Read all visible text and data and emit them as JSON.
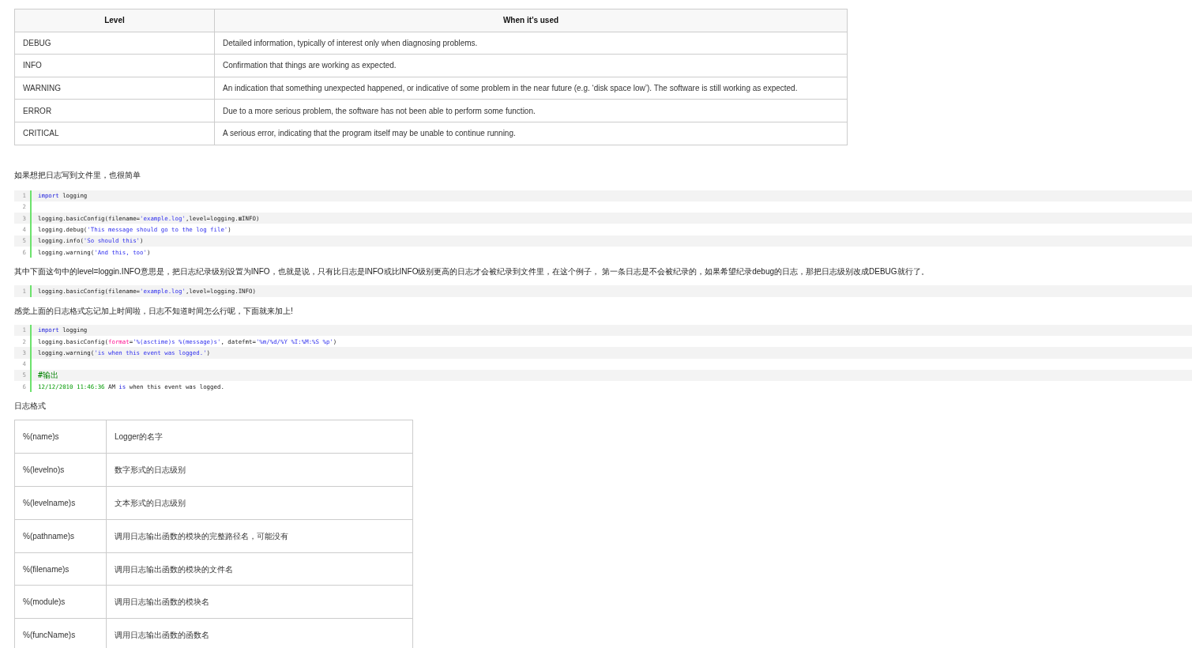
{
  "levels_table": {
    "columns": [
      "Level",
      "When it’s used"
    ],
    "rows": [
      [
        "DEBUG",
        "Detailed information, typically of interest only when diagnosing problems."
      ],
      [
        "INFO",
        "Confirmation that things are working as expected."
      ],
      [
        "WARNING",
        "An indication that something unexpected happened, or indicative of some problem in the near future (e.g. ‘disk space low’). The software is still working as expected."
      ],
      [
        "ERROR",
        "Due to a more serious problem, the software has not been able to perform some function."
      ],
      [
        "CRITICAL",
        "A serious error, indicating that the program itself may be unable to continue running."
      ]
    ]
  },
  "blocks": [
    {
      "kind": "para",
      "text": "如果想把日志写到文件里，也很简单"
    },
    {
      "kind": "code",
      "lines": [
        {
          "number": "1",
          "tokens": [
            {
              "kind": "keyword",
              "text": "import"
            },
            {
              "kind": "plain",
              "text": " logging"
            }
          ]
        },
        {
          "number": "2"
        },
        {
          "number": "3",
          "tokens": [
            {
              "kind": "plain",
              "text": "logging.basicConfig(filename="
            },
            {
              "kind": "string",
              "text": "'example.log'"
            },
            {
              "kind": "plain",
              "text": ",level=logging.⊠INFO)"
            }
          ]
        },
        {
          "number": "4",
          "tokens": [
            {
              "kind": "plain",
              "text": "logging.debug("
            },
            {
              "kind": "string",
              "text": "'This message should go to the log file'"
            },
            {
              "kind": "plain",
              "text": ")"
            }
          ]
        },
        {
          "number": "5",
          "tokens": [
            {
              "kind": "plain",
              "text": "logging.info("
            },
            {
              "kind": "string",
              "text": "'So should this'"
            },
            {
              "kind": "plain",
              "text": ")"
            }
          ]
        },
        {
          "number": "6",
          "tokens": [
            {
              "kind": "plain",
              "text": "logging.warning("
            },
            {
              "kind": "string",
              "text": "'And this, too'"
            },
            {
              "kind": "plain",
              "text": ")"
            }
          ]
        }
      ]
    },
    {
      "kind": "para",
      "text": "其中下面这句中的level=loggin.INFO意思是，把日志纪录级别设置为INFO，也就是说，只有比日志是INFO或比INFO级别更高的日志才会被纪录到文件里，在这个例子， 第一条日志是不会被纪录的，如果希望纪录debug的日志，那把日志级别改成DEBUG就行了。"
    },
    {
      "kind": "code",
      "lines": [
        {
          "number": "1",
          "tokens": [
            {
              "kind": "plain",
              "text": "logging.basicConfig(filename="
            },
            {
              "kind": "string",
              "text": "'example.log'"
            },
            {
              "kind": "plain",
              "text": ",level=logging.INFO)"
            }
          ]
        }
      ]
    },
    {
      "kind": "para",
      "text": "感觉上面的日志格式忘记加上时间啦，日志不知道时间怎么行呢，下面就来加上!"
    },
    {
      "kind": "code",
      "lines": [
        {
          "number": "1",
          "tokens": [
            {
              "kind": "keyword",
              "text": "import"
            },
            {
              "kind": "plain",
              "text": " logging"
            }
          ]
        },
        {
          "number": "2",
          "tokens": [
            {
              "kind": "plain",
              "text": "logging.basicConfig("
            },
            {
              "kind": "attr",
              "text": "format"
            },
            {
              "kind": "plain",
              "text": "="
            },
            {
              "kind": "string",
              "text": "'%(asctime)s %(message)s'"
            },
            {
              "kind": "plain",
              "text": ", datefmt="
            },
            {
              "kind": "string",
              "text": "'%m/%d/%Y %I:%M:%S %p'"
            },
            {
              "kind": "plain",
              "text": ")"
            }
          ]
        },
        {
          "number": "3",
          "tokens": [
            {
              "kind": "plain",
              "text": "logging.warning("
            },
            {
              "kind": "string",
              "text": "'is when this event was logged.'"
            },
            {
              "kind": "plain",
              "text": ")"
            }
          ]
        },
        {
          "number": "4"
        },
        {
          "number": "5",
          "tokens": [
            {
              "kind": "comment",
              "text": "#输出"
            }
          ]
        },
        {
          "number": "6",
          "tokens": [
            {
              "kind": "number",
              "text": "12/12/2010 11:46:36"
            },
            {
              "kind": "plain",
              "text": " AM "
            },
            {
              "kind": "keyword",
              "text": "is"
            },
            {
              "kind": "plain",
              "text": " when this event was logged."
            }
          ]
        }
      ]
    },
    {
      "kind": "para",
      "text": "日志格式"
    }
  ],
  "format_table": {
    "rows": [
      [
        "%(name)s",
        "Logger的名字"
      ],
      [
        "%(levelno)s",
        "数字形式的日志级别"
      ],
      [
        "%(levelname)s",
        "文本形式的日志级别"
      ],
      [
        "%(pathname)s",
        "调用日志输出函数的模块的完整路径名，可能没有"
      ],
      [
        "%(filename)s",
        "调用日志输出函数的模块的文件名"
      ],
      [
        "%(module)s",
        "调用日志输出函数的模块名"
      ],
      [
        "%(funcName)s",
        "调用日志输出函数的函数名"
      ]
    ]
  }
}
